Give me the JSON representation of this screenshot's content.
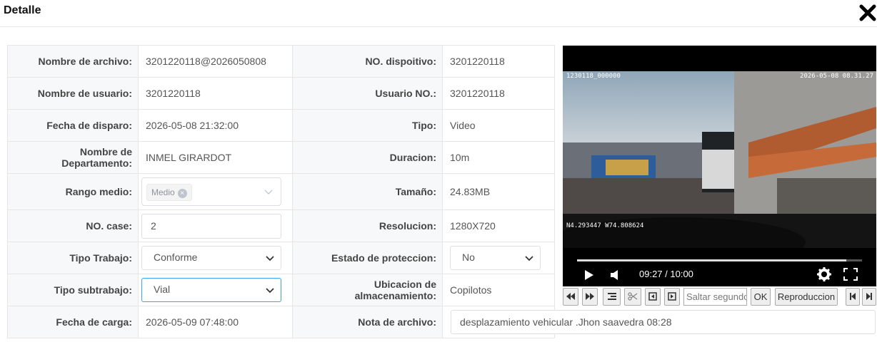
{
  "dialog": {
    "title": "Detalle",
    "close_icon": "close-icon"
  },
  "fields": {
    "nombre_archivo": {
      "label": "Nombre de archivo:",
      "value": "3201220118@2026050808"
    },
    "no_dispositivo": {
      "label": "NO. dispoitivo:",
      "value": "3201220118"
    },
    "nombre_usuario": {
      "label": "Nombre de usuario:",
      "value": "3201220118"
    },
    "usuario_no": {
      "label": "Usuario NO.:",
      "value": "3201220118"
    },
    "fecha_disparo": {
      "label": "Fecha de disparo:",
      "value": "2026-05-08 21:32:00"
    },
    "tipo": {
      "label": "Tipo:",
      "value": "Video"
    },
    "departamento": {
      "label": "Nombre de Departamento:",
      "value": "INMEL GIRARDOT"
    },
    "duracion": {
      "label": "Duracion:",
      "value": "10m"
    },
    "rango_medio": {
      "label": "Rango medio:",
      "tag": "Medio"
    },
    "tamano": {
      "label": "Tamaño:",
      "value": "24.83MB"
    },
    "no_case": {
      "label": "NO. case:",
      "value": "2"
    },
    "resolucion": {
      "label": "Resolucion:",
      "value": "1280X720"
    },
    "tipo_trabajo": {
      "label": "Tipo Trabajo:",
      "value": "Conforme"
    },
    "estado_proteccion": {
      "label": "Estado de proteccion:",
      "value": "No"
    },
    "tipo_subtrabajo": {
      "label": "Tipo subtrabajo:",
      "value": "Vial"
    },
    "ubicacion": {
      "label": "Ubicacion de almacenamiento:",
      "value": "Copilotos"
    },
    "fecha_carga": {
      "label": "Fecha de carga:",
      "value": "2026-05-09 07:48:00"
    },
    "nota_archivo": {
      "label": "Nota de archivo:",
      "value": "desplazamiento vehicular .Jhon saavedra 08:28"
    }
  },
  "player": {
    "overlay_id": "1230118_000000",
    "overlay_datetime": "2026-05-08 08.31.27",
    "overlay_gps": "N4.293447 W74.808624",
    "time": "09:27 / 10:00",
    "progress": 0.945,
    "icons": [
      "play-icon",
      "volume-icon",
      "settings-icon",
      "fullscreen-icon"
    ]
  },
  "toolbar": {
    "seek_placeholder": "Saltar segundos",
    "ok_label": "OK",
    "playback_label": "Reproduccion",
    "icons": [
      "rewind-icon",
      "fast-forward-icon",
      "list-icon",
      "scissors-icon",
      "prev-frame-icon",
      "next-frame-icon",
      "skip-start-icon",
      "skip-end-icon"
    ]
  }
}
